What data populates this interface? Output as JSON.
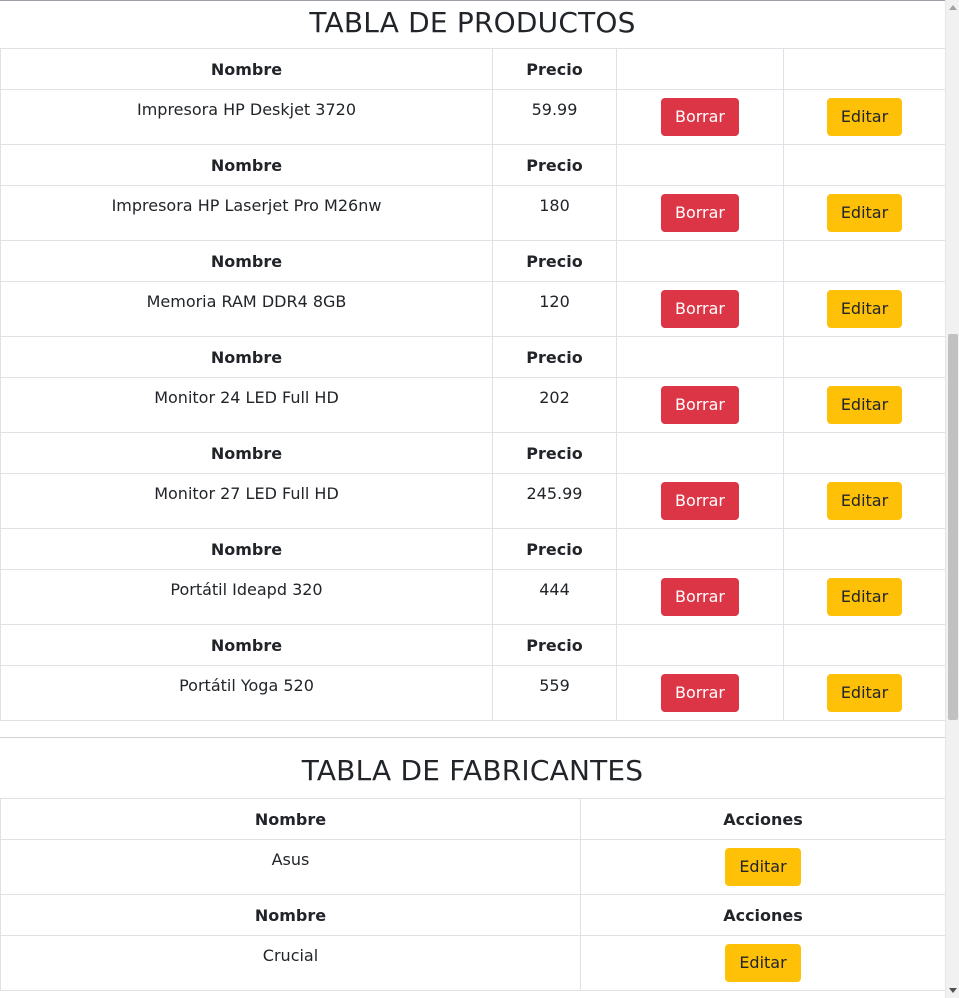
{
  "products": {
    "title": "TABLA DE PRODUCTOS",
    "header_name": "Nombre",
    "header_price": "Precio",
    "delete_label": "Borrar",
    "edit_label": "Editar",
    "rows": [
      {
        "name": "Impresora HP Deskjet 3720",
        "price": "59.99"
      },
      {
        "name": "Impresora HP Laserjet Pro M26nw",
        "price": "180"
      },
      {
        "name": "Memoria RAM DDR4 8GB",
        "price": "120"
      },
      {
        "name": "Monitor 24 LED Full HD",
        "price": "202"
      },
      {
        "name": "Monitor 27 LED Full HD",
        "price": "245.99"
      },
      {
        "name": "Portátil Ideapd 320",
        "price": "444"
      },
      {
        "name": "Portátil Yoga 520",
        "price": "559"
      }
    ]
  },
  "manufacturers": {
    "title": "TABLA DE FABRICANTES",
    "header_name": "Nombre",
    "header_actions": "Acciones",
    "edit_label": "Editar",
    "rows": [
      {
        "name": "Asus"
      },
      {
        "name": "Crucial"
      }
    ]
  },
  "colors": {
    "danger": "#dc3545",
    "warning": "#ffc107",
    "border": "#dee2e6",
    "text": "#212529"
  }
}
